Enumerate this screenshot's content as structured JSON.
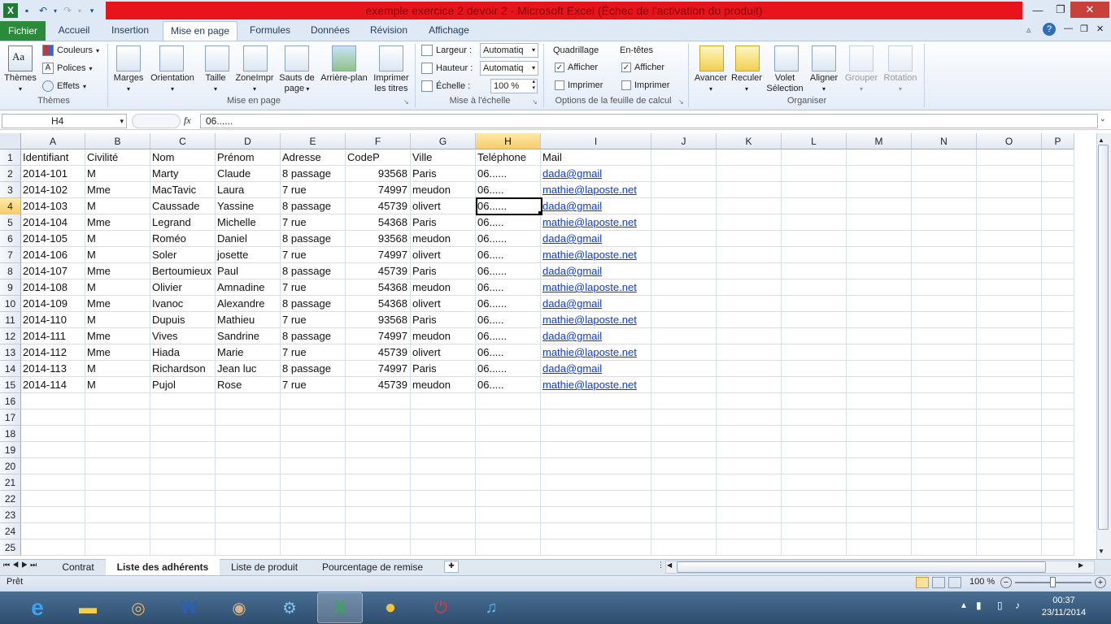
{
  "window": {
    "title": "exemple exercice 2 devoir 2  -  Microsoft Excel (Échec de l'activation du produit)"
  },
  "ribbon_tabs": [
    "Fichier",
    "Accueil",
    "Insertion",
    "Mise en page",
    "Formules",
    "Données",
    "Révision",
    "Affichage"
  ],
  "ribbon": {
    "themes": {
      "themes": "Thèmes",
      "couleurs": "Couleurs",
      "polices": "Polices",
      "effets": "Effets",
      "group": "Thèmes"
    },
    "mise_en_page": {
      "marges": "Marges",
      "orientation": "Orientation",
      "taille": "Taille",
      "zone": "ZoneImpr",
      "sauts": "Sauts de",
      "sauts2": "page",
      "arriere": "Arrière-plan",
      "imprimer_titres": "Imprimer",
      "imprimer_titres2": "les titres",
      "group": "Mise en page"
    },
    "echelle": {
      "largeur": "Largeur :",
      "largeur_val": "Automatiq",
      "hauteur": "Hauteur :",
      "hauteur_val": "Automatiq",
      "echelle": "Échelle :",
      "echelle_val": "100 %",
      "group": "Mise à l'échelle"
    },
    "options": {
      "quadrillage": "Quadrillage",
      "entetes": "En-têtes",
      "afficher": "Afficher",
      "imprimer": "Imprimer",
      "group": "Options de la feuille de calcul"
    },
    "organiser": {
      "avancer": "Avancer",
      "reculer": "Reculer",
      "volet": "Volet",
      "volet2": "Sélection",
      "aligner": "Aligner",
      "grouper": "Grouper",
      "rotation": "Rotation",
      "group": "Organiser"
    }
  },
  "formula_bar": {
    "name_box": "H4",
    "fx": "fx",
    "value": "06......"
  },
  "columns": [
    "A",
    "B",
    "C",
    "D",
    "E",
    "F",
    "G",
    "H",
    "I",
    "J",
    "K",
    "L",
    "M",
    "N",
    "O",
    "P"
  ],
  "rows_count": 25,
  "table": [
    [
      "Identifiant",
      "Civilité",
      "Nom",
      "Prénom",
      "Adresse",
      "CodeP",
      "Ville",
      "Teléphone",
      "Mail"
    ],
    [
      "2014-101",
      "M",
      "Marty",
      "Claude",
      "8 passage",
      "93568",
      "Paris",
      "06......",
      "dada@gmail"
    ],
    [
      "2014-102",
      "Mme",
      "MacTavic",
      "Laura",
      "7 rue",
      "74997",
      "meudon",
      "06.....",
      "mathie@laposte.net"
    ],
    [
      "2014-103",
      "M",
      "Caussade",
      "Yassine",
      "8 passage",
      "45739",
      "olivert",
      "06......",
      "dada@gmail"
    ],
    [
      "2014-104",
      "Mme",
      "Legrand",
      "Michelle",
      "7 rue",
      "54368",
      "Paris",
      "06.....",
      "mathie@laposte.net"
    ],
    [
      "2014-105",
      "M",
      "Roméo",
      "Daniel",
      "8 passage",
      "93568",
      "meudon",
      "06......",
      "dada@gmail"
    ],
    [
      "2014-106",
      "M",
      "Soler",
      "josette",
      "7 rue",
      "74997",
      "olivert",
      "06.....",
      "mathie@laposte.net"
    ],
    [
      "2014-107",
      "Mme",
      "Bertoumieux",
      "Paul",
      "8 passage",
      "45739",
      "Paris",
      "06......",
      "dada@gmail"
    ],
    [
      "2014-108",
      "M",
      "Olivier",
      "Amnadine",
      "7 rue",
      "54368",
      "meudon",
      "06.....",
      "mathie@laposte.net"
    ],
    [
      "2014-109",
      "Mme",
      "Ivanoc",
      "Alexandre",
      "8 passage",
      "54368",
      "olivert",
      "06......",
      "dada@gmail"
    ],
    [
      "2014-110",
      "M",
      "Dupuis",
      "Mathieu",
      "7 rue",
      "93568",
      "Paris",
      "06.....",
      "mathie@laposte.net"
    ],
    [
      "2014-111",
      "Mme",
      "Vives",
      "Sandrine",
      "8 passage",
      "74997",
      "meudon",
      "06......",
      "dada@gmail"
    ],
    [
      "2014-112",
      "Mme",
      "Hiada",
      "Marie",
      "7 rue",
      "45739",
      "olivert",
      "06.....",
      "mathie@laposte.net"
    ],
    [
      "2014-113",
      "M",
      "Richardson",
      "Jean luc",
      "8 passage",
      "74997",
      "Paris",
      "06......",
      "dada@gmail"
    ],
    [
      "2014-114",
      "M",
      "Pujol",
      "Rose",
      "7 rue",
      "45739",
      "meudon",
      "06.....",
      "mathie@laposte.net"
    ]
  ],
  "sheets": [
    "Contrat",
    "Liste des adhérents",
    "Liste de produit",
    "Pourcentage de remise"
  ],
  "active_sheet": "Liste des adhérents",
  "status": {
    "ready": "Prêt",
    "zoom": "100 %"
  },
  "taskbar": {
    "time": "00:37",
    "date": "23/11/2014"
  },
  "colors": {
    "accent": "#2a8b3b",
    "title_bar": "#e8141b",
    "link": "#0b3ad6",
    "selected_header": "#f8cc6b"
  }
}
